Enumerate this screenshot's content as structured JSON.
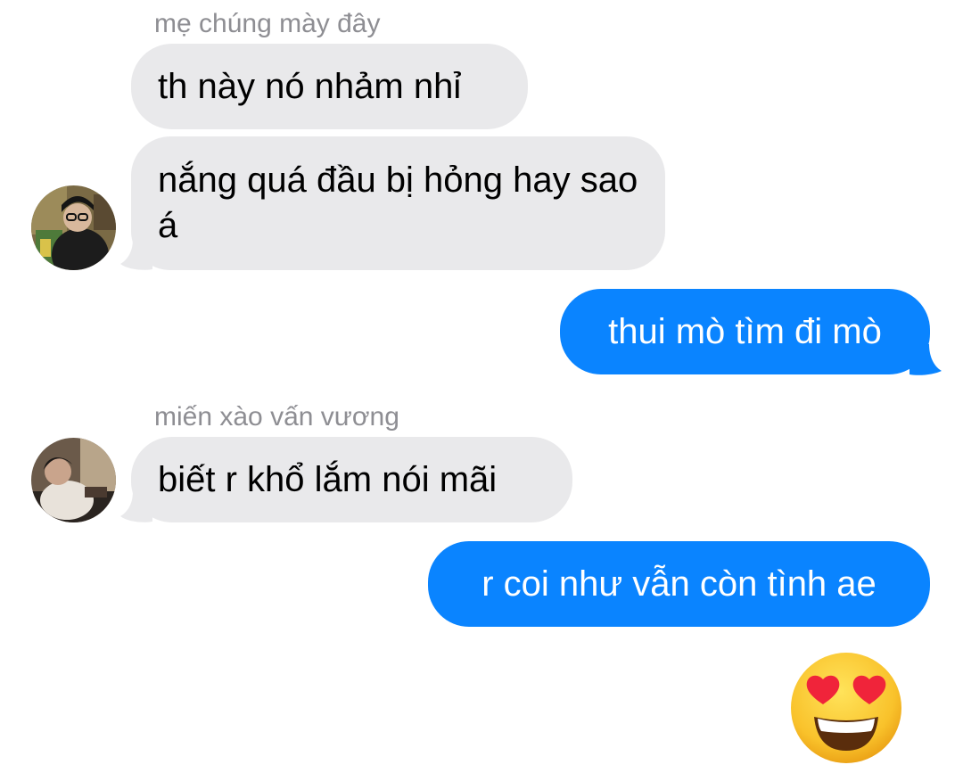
{
  "thread": {
    "group1": {
      "sender": "mẹ chúng mày đây",
      "messages": [
        "th này nó nhảm nhỉ",
        "nắng quá đầu bị hỏng hay sao á"
      ]
    },
    "outgoing1": "thui mò tìm đi mò",
    "group2": {
      "sender": "miến xào vấn vương",
      "messages": [
        "biết r khổ lắm nói mãi"
      ]
    },
    "outgoing2": "r coi như vẫn còn tình ae",
    "reaction_emoji": "smiling-face-with-heart-eyes"
  },
  "colors": {
    "incoming_bubble": "#e9e9eb",
    "outgoing_bubble": "#0a84ff",
    "sender_name": "#8e8e93"
  }
}
